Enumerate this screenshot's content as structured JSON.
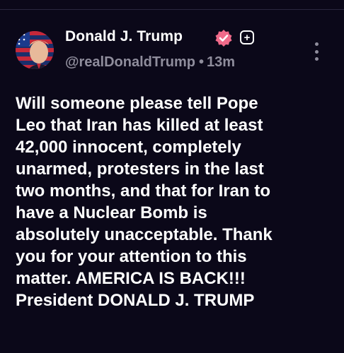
{
  "post": {
    "author": {
      "display_name": "Donald J. Trump",
      "handle": "@realDonaldTrump",
      "verified_icon": "verified-badge-icon",
      "follow_icon": "plus-icon",
      "avatar_icon": "profile-avatar-flag-portrait"
    },
    "time_separator": "•",
    "timestamp": "13m",
    "more_icon": "vertical-ellipsis-icon",
    "body_lines": [
      "Will someone please tell Pope",
      "Leo that Iran has killed at least",
      "42,000 innocent, completely",
      "unarmed, protesters in the last",
      "two months, and that for Iran to",
      "have a Nuclear Bomb is",
      "absolutely unacceptable. Thank",
      "you for your attention to this",
      "matter. AMERICA IS BACK!!!",
      "President DONALD J. TRUMP"
    ]
  },
  "colors": {
    "background": "#0b0819",
    "text": "#ffffff",
    "muted_text": "#8f8d9c",
    "verified_badge": "#f06a8a"
  }
}
